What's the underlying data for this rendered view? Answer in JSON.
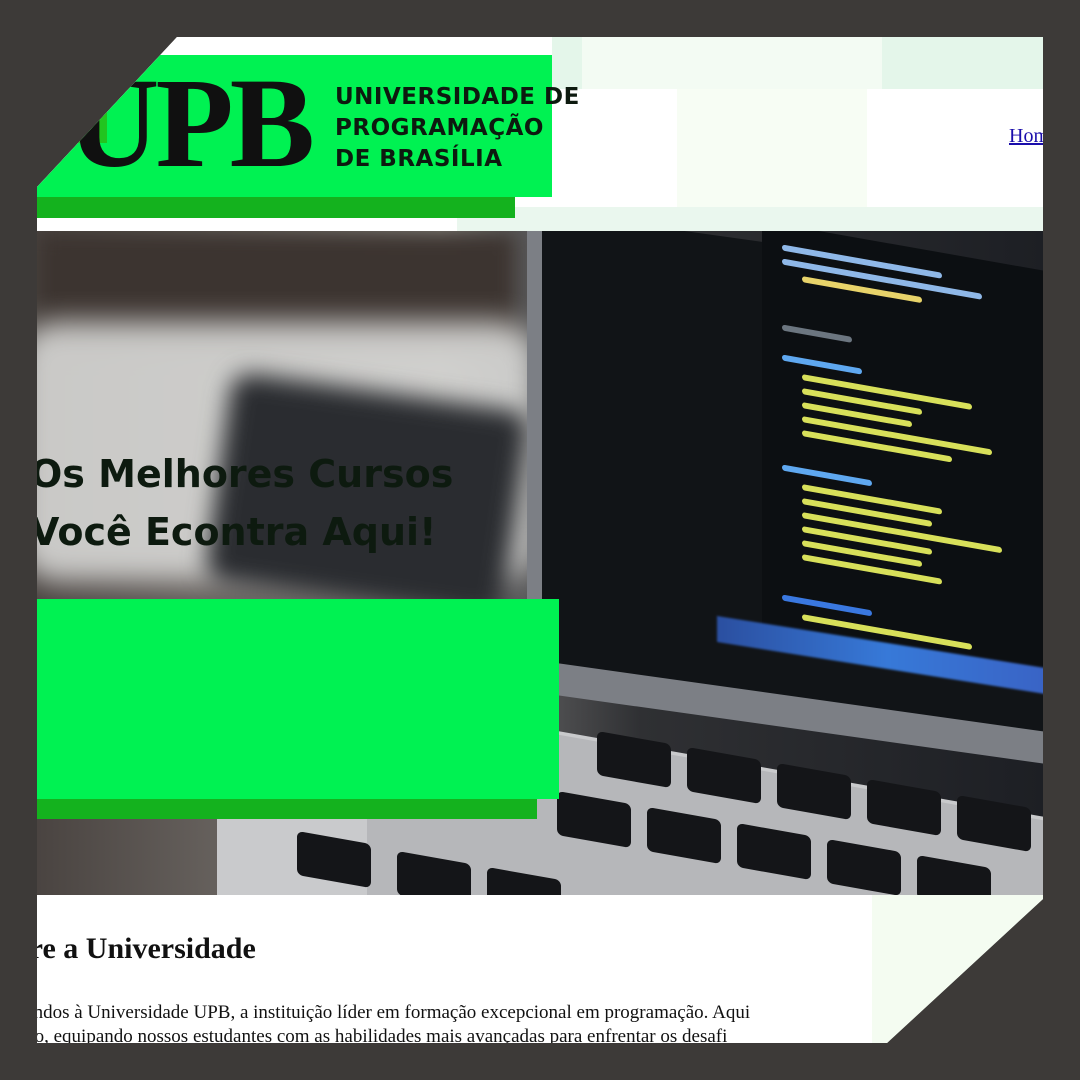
{
  "header": {
    "logo_mark": "UPB",
    "logo_name_lines": [
      "UNIVERSIDADE DE",
      "PROGRAMAÇÃO",
      "DE BRASÍLIA"
    ],
    "nav_home": "Hom"
  },
  "hero": {
    "title_lines": [
      "Os Melhores Cursos",
      "Você Econtra Aqui!"
    ]
  },
  "about": {
    "heading": "bre a Universidade",
    "text_lines": [
      "n-vindos à Universidade UPB, a instituição líder em formação excepcional em programação. Aqui",
      "ração, equipando nossos estudantes com as habilidades mais avançadas para enfrentar os desafi"
    ]
  },
  "colors": {
    "brand_green": "#00f252",
    "brand_green_dark": "#14b21e",
    "frame": "#3d3a38",
    "link": "#1a0dab"
  }
}
